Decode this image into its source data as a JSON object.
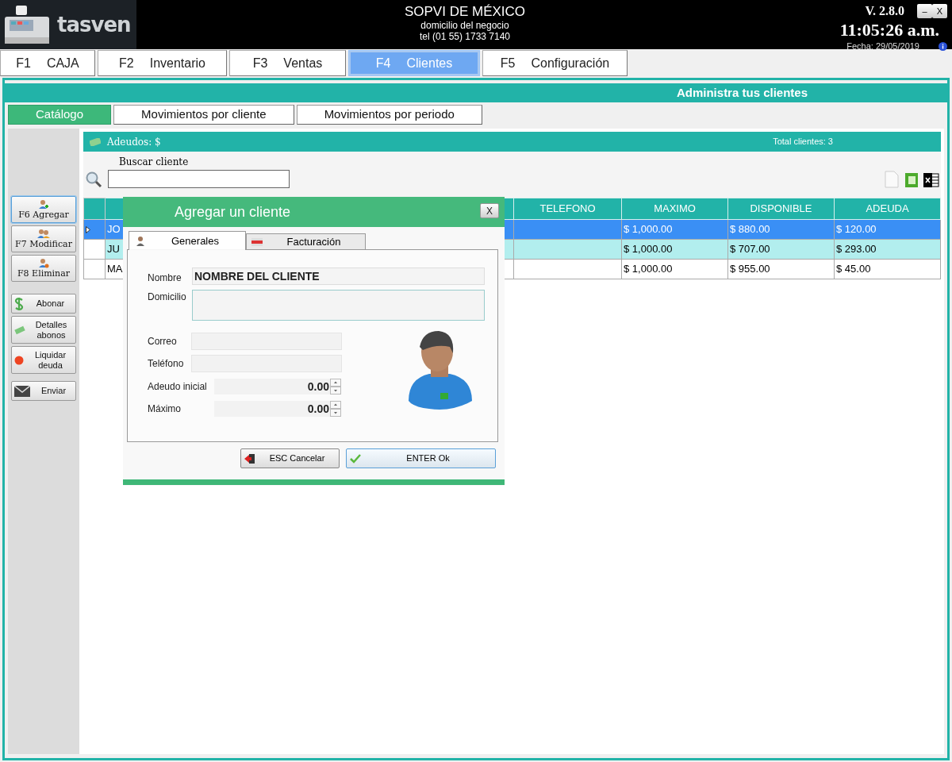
{
  "header": {
    "logo_text": "tasven",
    "business_name": "SOPVI DE MÉXICO",
    "address": "domicilio del negocio",
    "phone": "tel (01 55) 1733 7140",
    "version": "V. 2.8.0",
    "minimize": "–",
    "close": "X",
    "time": "11:05:26 a.m.",
    "date": "Fecha: 29/05/2019"
  },
  "menu_tabs": [
    {
      "key": "F1",
      "label": "CAJA",
      "selected": false
    },
    {
      "key": "F2",
      "label": "Inventario",
      "selected": false
    },
    {
      "key": "F3",
      "label": "Ventas",
      "selected": false
    },
    {
      "key": "F4",
      "label": "Clientes",
      "selected": true
    },
    {
      "key": "F5",
      "label": "Configuración",
      "selected": false
    }
  ],
  "panel_title": "Administra tus clientes",
  "sub_tabs": [
    {
      "label": "Catálogo",
      "selected": true
    },
    {
      "label": "Movimientos por cliente",
      "selected": false
    },
    {
      "label": "Movimientos por periodo",
      "selected": false
    }
  ],
  "sidebar": [
    {
      "kind": "stacked",
      "label": "F6 Agregar",
      "selected": true
    },
    {
      "kind": "stacked",
      "label": "F7 Modificar",
      "selected": false
    },
    {
      "kind": "stacked",
      "label": "F8 Eliminar",
      "selected": false
    },
    {
      "kind": "inline",
      "label": "Abonar",
      "selected": false
    },
    {
      "kind": "inline",
      "label": "Detalles abonos",
      "selected": false
    },
    {
      "kind": "inline",
      "label": "Liquidar deuda",
      "selected": false
    },
    {
      "kind": "inline",
      "label": "Enviar",
      "selected": false
    }
  ],
  "summary_bar": {
    "debts": "Adeudos: $",
    "total": "Total clientes: 3"
  },
  "search": {
    "label": "Buscar cliente"
  },
  "table": {
    "columns": [
      null,
      null,
      null,
      "TELEFONO",
      "MAXIMO",
      "DISPONIBLE",
      "ADEUDA"
    ],
    "rows": [
      {
        "selected": true,
        "cells": [
          "JO",
          null,
          null,
          null,
          "$ 1,000.00",
          "$ 880.00",
          "$ 120.00"
        ]
      },
      {
        "selected": false,
        "cells": [
          "JU",
          null,
          null,
          null,
          "$ 1,000.00",
          "$ 707.00",
          "$ 293.00"
        ]
      },
      {
        "selected": false,
        "cells": [
          "MA",
          null,
          null,
          null,
          "$ 1,000.00",
          "$ 955.00",
          "$ 45.00"
        ]
      }
    ]
  },
  "dialog": {
    "title": "Agregar un cliente",
    "close": "X",
    "tabs": [
      {
        "label": "Generales",
        "selected": true
      },
      {
        "label": "Facturación",
        "selected": false
      }
    ],
    "name": {
      "label": "Nombre",
      "value": "NOMBRE DEL CLIENTE"
    },
    "address": {
      "label": "Domicilio"
    },
    "email": {
      "label": "Correo"
    },
    "phone": {
      "label": "Teléfono"
    },
    "initial_debt": {
      "label": "Adeudo inicial",
      "value": "0.00"
    },
    "maximum": {
      "label": "Máximo",
      "value": "0.00"
    },
    "cancel": "ESC Cancelar",
    "ok": "ENTER Ok"
  }
}
